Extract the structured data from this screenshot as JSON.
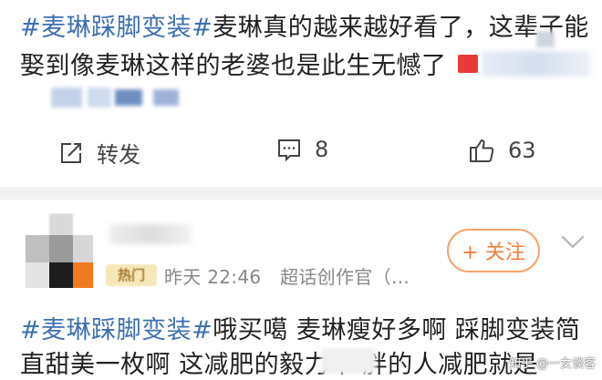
{
  "post1": {
    "hashtag": "#麦琳踩脚变装#",
    "line1_text": "麦琳真的越来越好看了，这辈子能",
    "line2_text": "娶到像麦琳这样的老婆也是此生无憾了",
    "actions": {
      "repost_label": "转发",
      "comment_count": "8",
      "like_count": "63"
    }
  },
  "post2": {
    "badge": "热门",
    "timestamp": "昨天 22:46",
    "source": "超话创作官（…",
    "follow_label": "+ 关注",
    "hashtag": "#麦琳踩脚变装#",
    "line1_text": "哦买噶  麦琳瘦好多啊  踩脚变装简",
    "line2_text": "直甜美一枚啊 这减肥的毅力牛    胖的人减肥就是"
  },
  "watermark": "知乎 @一女谈客",
  "colors": {
    "hashtag": "#3d6fb1",
    "follow": "#f37f3a",
    "badge_bg": "#f6e7b9"
  }
}
